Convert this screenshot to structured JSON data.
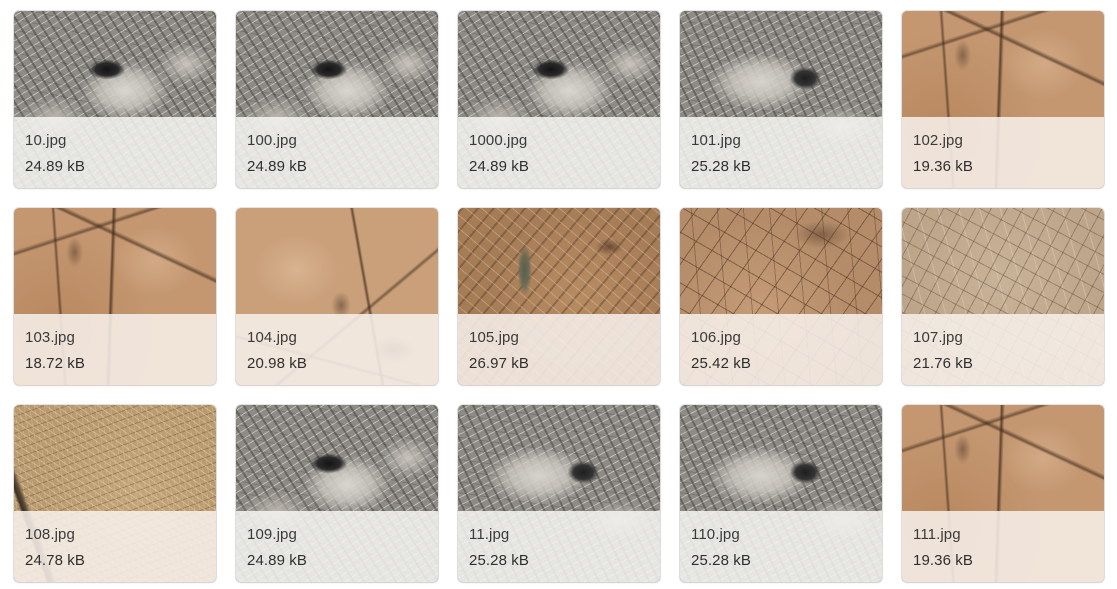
{
  "files": [
    {
      "name": "10.jpg",
      "size": "24.89 kB",
      "texture": "gray"
    },
    {
      "name": "100.jpg",
      "size": "24.89 kB",
      "texture": "gray"
    },
    {
      "name": "1000.jpg",
      "size": "24.89 kB",
      "texture": "gray"
    },
    {
      "name": "101.jpg",
      "size": "25.28 kB",
      "texture": "gray-v2"
    },
    {
      "name": "102.jpg",
      "size": "19.36 kB",
      "texture": "tan"
    },
    {
      "name": "103.jpg",
      "size": "18.72 kB",
      "texture": "tan"
    },
    {
      "name": "104.jpg",
      "size": "20.98 kB",
      "texture": "tan-v2"
    },
    {
      "name": "105.jpg",
      "size": "26.97 kB",
      "texture": "leaf"
    },
    {
      "name": "106.jpg",
      "size": "25.42 kB",
      "texture": "crack"
    },
    {
      "name": "107.jpg",
      "size": "21.76 kB",
      "texture": "pale"
    },
    {
      "name": "108.jpg",
      "size": "24.78 kB",
      "texture": "straw"
    },
    {
      "name": "109.jpg",
      "size": "24.89 kB",
      "texture": "gray"
    },
    {
      "name": "11.jpg",
      "size": "25.28 kB",
      "texture": "gray-v2"
    },
    {
      "name": "110.jpg",
      "size": "25.28 kB",
      "texture": "gray-v2"
    },
    {
      "name": "111.jpg",
      "size": "19.36 kB",
      "texture": "tan"
    }
  ]
}
